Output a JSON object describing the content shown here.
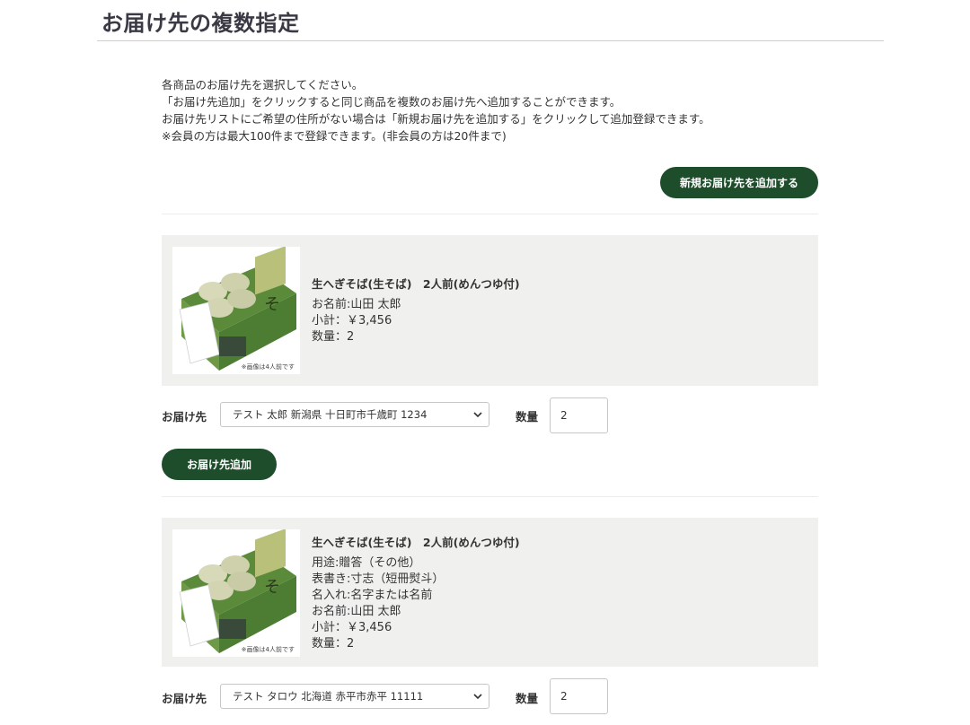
{
  "page": {
    "title": "お届け先の複数指定",
    "intro_lines": [
      "各商品のお届け先を選択してください。",
      "「お届け先追加」をクリックすると同じ商品を複数のお届け先へ追加することができます。",
      "お届け先リストにご希望の住所がない場合は「新規お届け先を追加する」をクリックして追加登録できます。",
      "※会員の方は最大100件まで登録できます。(非会員の方は20件まで)"
    ],
    "add_new_address_label": "新規お届け先を追加する"
  },
  "items": [
    {
      "product_name": "生へぎそば(生そば)　2人前(めんつゆ付)",
      "image_caption": "※画像は4人前です",
      "details": [
        "お名前:山田 太郎",
        "小計：￥3,456",
        "数量：2"
      ],
      "destination_label": "お届け先",
      "destination_value": "テスト 太郎 新潟県 十日町市千歳町 1234",
      "quantity_label": "数量",
      "quantity_value": "2",
      "add_destination_label": "お届け先追加"
    },
    {
      "product_name": "生へぎそば(生そば)　2人前(めんつゆ付)",
      "image_caption": "※画像は4人前です",
      "details": [
        "用途:贈答（その他）",
        "表書き:寸志（短冊熨斗）",
        "名入れ:名字または名前",
        "お名前:山田 太郎",
        "小計：￥3,456",
        "数量：2"
      ],
      "destination_label": "お届け先",
      "destination_value": "テスト タロウ 北海道 赤平市赤平 11111",
      "quantity_label": "数量",
      "quantity_value": "2"
    }
  ],
  "colors": {
    "button_green": "#1e4d2b",
    "card_bg": "#f0f1ef"
  }
}
